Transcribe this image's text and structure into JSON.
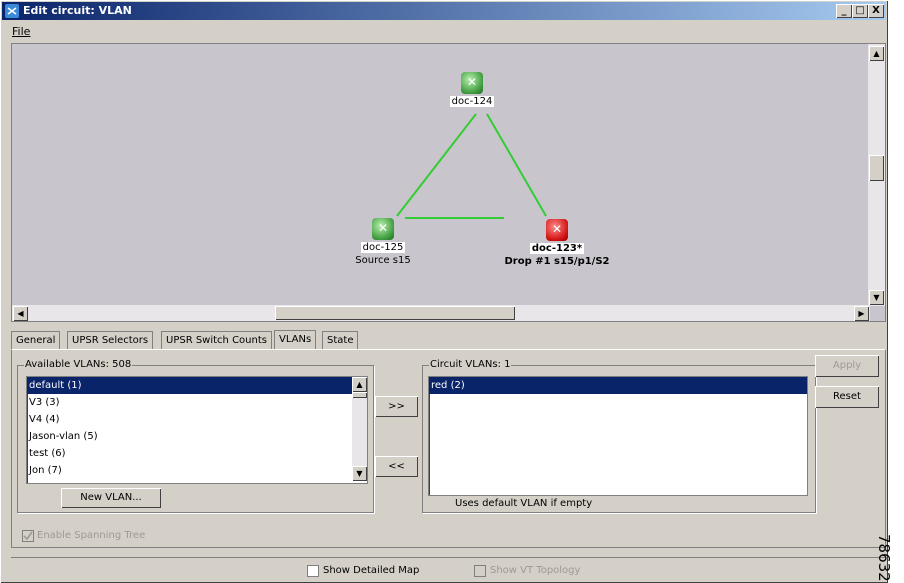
{
  "window": {
    "title": "Edit circuit: VLAN",
    "controls": [
      "_",
      "□",
      "X"
    ]
  },
  "menu": {
    "file": "File"
  },
  "map": {
    "nodes": [
      {
        "name": "doc-124",
        "sub": "",
        "status": "ok"
      },
      {
        "name": "doc-125",
        "sub": "Source s15",
        "status": "ok"
      },
      {
        "name": "doc-123*",
        "sub": "Drop #1 s15/p1/S2",
        "status": "alarm"
      }
    ]
  },
  "tabs": [
    "General",
    "UPSR Selectors",
    "UPSR Switch Counts",
    "VLANs",
    "State"
  ],
  "active_tab": "VLANs",
  "available": {
    "title": "Available VLANs: 508",
    "items": [
      "default (1)",
      "V3 (3)",
      "V4 (4)",
      "Jason-vlan (5)",
      "test (6)",
      "Jon (7)"
    ],
    "selected_index": 0,
    "new_button": "New VLAN..."
  },
  "transfer": {
    "add": ">>",
    "remove": "<<"
  },
  "circuit": {
    "title": "Circuit VLANs: 1",
    "items": [
      "red (2)"
    ],
    "note": "Uses default VLAN if empty"
  },
  "buttons": {
    "apply": "Apply",
    "reset": "Reset"
  },
  "spanning_tree": {
    "label": "Enable Spanning Tree",
    "checked": true,
    "enabled": false
  },
  "bottom": {
    "detailed_map": "Show Detailed Map",
    "vt_topology": "Show VT Topology"
  },
  "figure_id": "78632",
  "colors": {
    "title_bar": "#0a246a",
    "link": "#33cc33",
    "selection": "#0a246a",
    "node_ok": "#3c9a3c",
    "node_alarm": "#d01010"
  }
}
